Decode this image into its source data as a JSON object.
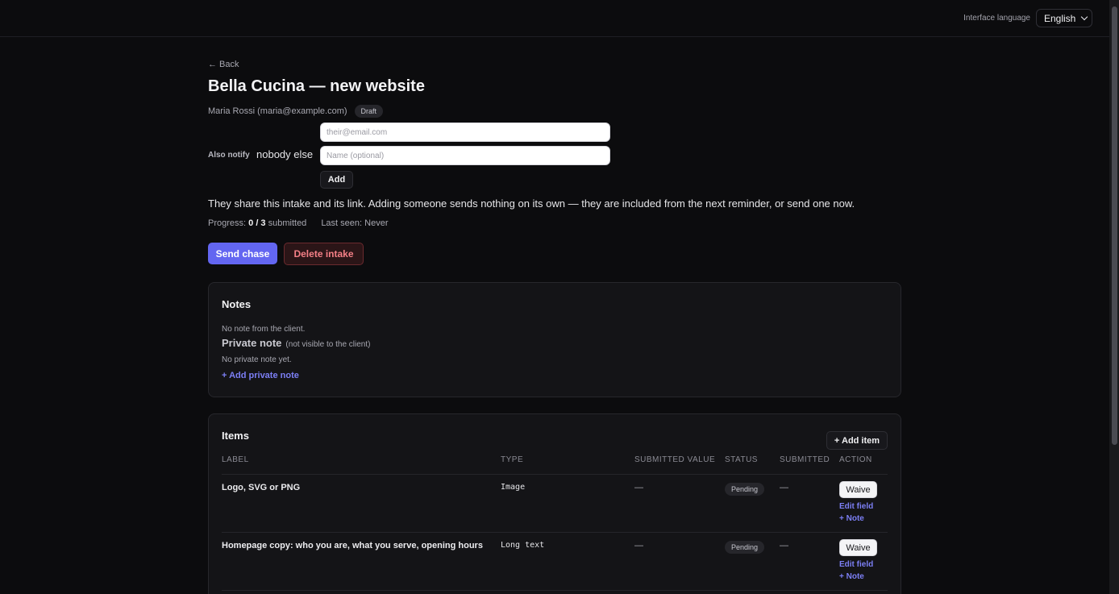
{
  "topbar": {
    "language_label": "Interface language",
    "language_value": "English"
  },
  "back_label": "← Back",
  "title": "Bella Cucina — new website",
  "client": "Maria Rossi (maria@example.com)",
  "status_badge": "Draft",
  "notify": {
    "label": "Also notify",
    "value": "nobody else",
    "email_placeholder": "their@email.com",
    "name_placeholder": "Name (optional)",
    "add_label": "Add"
  },
  "info_text": "They share this intake and its link. Adding someone sends nothing on its own — they are included from the next reminder, or send one now.",
  "progress": {
    "label": "Progress:",
    "value": "0 / 3",
    "suffix": "submitted",
    "last_seen_label": "Last seen:",
    "last_seen_value": "Never"
  },
  "actions": {
    "send_chase": "Send chase",
    "delete_intake": "Delete intake"
  },
  "notes": {
    "title": "Notes",
    "client_note": "No note from the client.",
    "private_title": "Private note",
    "private_hint": "(not visible to the client)",
    "private_empty": "No private note yet.",
    "add_private": "+ Add private note"
  },
  "items": {
    "title": "Items",
    "add_item": "+ Add item",
    "columns": [
      "LABEL",
      "TYPE",
      "SUBMITTED VALUE",
      "STATUS",
      "SUBMITTED",
      "ACTION"
    ],
    "rows": [
      {
        "label": "Logo, SVG or PNG",
        "type": "Image",
        "value": "—",
        "status": "Pending",
        "submitted": "—",
        "waive": "Waive",
        "edit": "Edit field",
        "note": "+ Note"
      },
      {
        "label": "Homepage copy: who you are, what you serve, opening hours",
        "type": "Long text",
        "value": "—",
        "status": "Pending",
        "submitted": "—",
        "waive": "Waive",
        "edit": "Edit field",
        "note": "+ Note"
      }
    ]
  },
  "colors": {
    "accent": "#6366f1",
    "danger": "#f47f86",
    "background": "#0c0c0e",
    "card": "#141417"
  }
}
